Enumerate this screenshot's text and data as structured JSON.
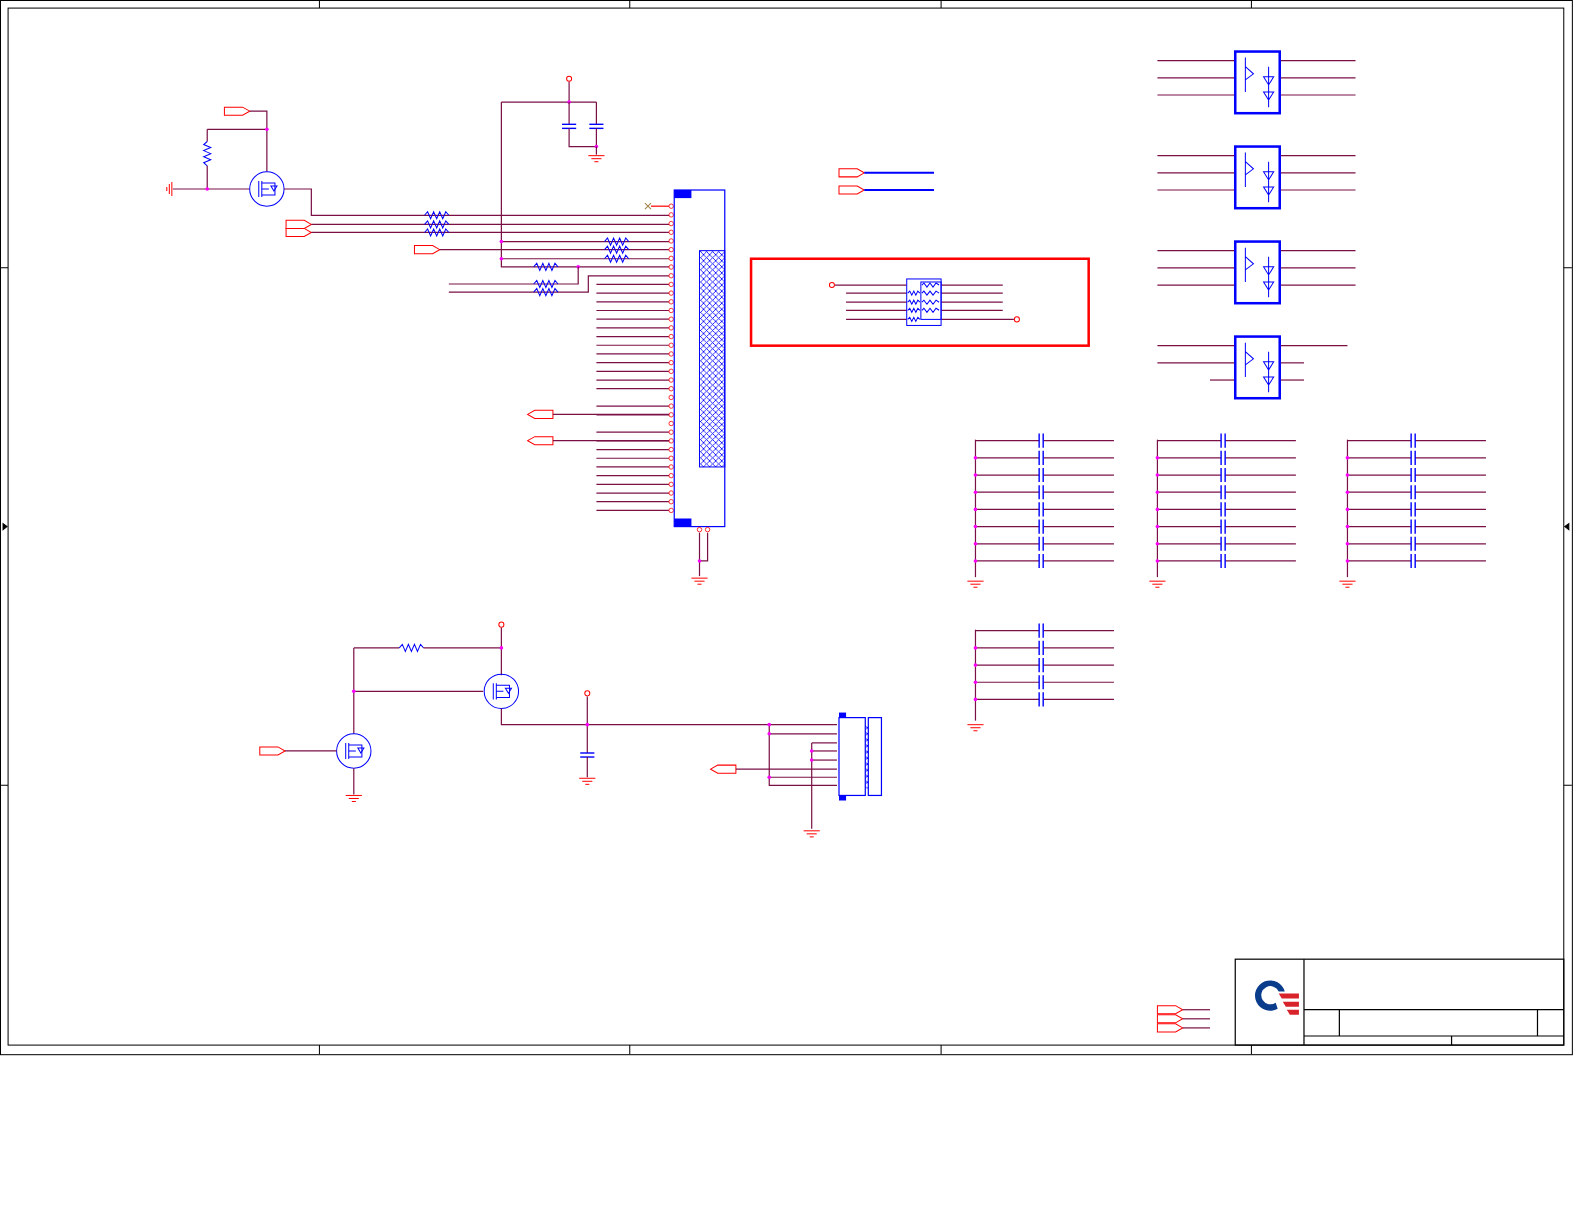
{
  "sheet": {
    "kind": "schematic"
  }
}
